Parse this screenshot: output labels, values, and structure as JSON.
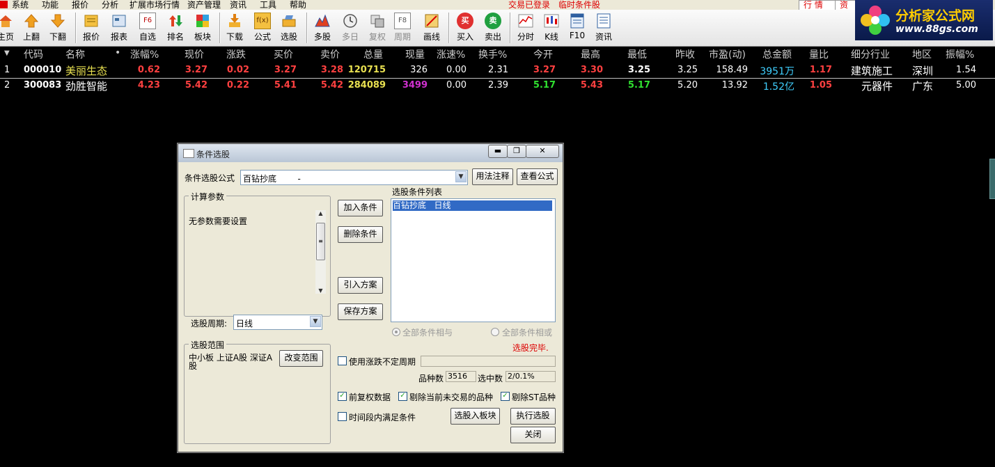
{
  "menubar": {
    "items": [
      "系统",
      "功能",
      "报价",
      "分析",
      "扩展市场行情",
      "资产管理",
      "资讯",
      "工具",
      "帮助"
    ],
    "status_login": "交易已登录",
    "status_temp": "临时条件股",
    "tabs": [
      "行 情",
      "资"
    ]
  },
  "toolbar": {
    "buttons": [
      {
        "label": "主页",
        "icon": "home-icon"
      },
      {
        "label": "上翻",
        "icon": "arrow-up-icon"
      },
      {
        "label": "下翻",
        "icon": "arrow-down-icon"
      },
      {
        "label": "报价",
        "icon": "quote-icon"
      },
      {
        "label": "报表",
        "icon": "report-icon"
      },
      {
        "label": "自选",
        "icon": "f6-key-icon",
        "key": "F6"
      },
      {
        "label": "排名",
        "icon": "ranking-icon"
      },
      {
        "label": "板块",
        "icon": "sector-icon"
      },
      {
        "label": "下载",
        "icon": "download-icon"
      },
      {
        "label": "公式",
        "icon": "formula-icon",
        "key": "f(x)"
      },
      {
        "label": "选股",
        "icon": "stock-pick-icon"
      },
      {
        "label": "多股",
        "icon": "multi-stock-icon"
      },
      {
        "label": "多日",
        "icon": "clock-icon"
      },
      {
        "label": "复权",
        "icon": "restore-icon"
      },
      {
        "label": "周期",
        "icon": "f8-key-icon",
        "key": "F8"
      },
      {
        "label": "画线",
        "icon": "draw-line-icon"
      },
      {
        "label": "买入",
        "icon": "buy-icon",
        "key": "买"
      },
      {
        "label": "卖出",
        "icon": "sell-icon",
        "key": "卖"
      },
      {
        "label": "分时",
        "icon": "intraday-icon"
      },
      {
        "label": "K线",
        "icon": "kline-icon"
      },
      {
        "label": "F10",
        "icon": "f10-icon"
      },
      {
        "label": "资讯",
        "icon": "news-icon"
      }
    ]
  },
  "brand": {
    "title": "分析家公式网",
    "url": "www.88gs.com"
  },
  "table": {
    "headers": [
      "代码",
      "名称",
      "•",
      "涨幅%",
      "现价",
      "涨跌",
      "买价",
      "卖价",
      "总量",
      "现量",
      "涨速%",
      "换手%",
      "今开",
      "最高",
      "最低",
      "昨收",
      "市盈(动)",
      "总金额",
      "量比",
      "细分行业",
      "地区",
      "振幅%"
    ],
    "rows": [
      [
        "1",
        "000010",
        "美丽生态",
        "0.62",
        "3.27",
        "0.02",
        "3.27",
        "3.28",
        "120715",
        "326",
        "0.00",
        "2.31",
        "3.27",
        "3.30",
        "3.25",
        "3.25",
        "158.49",
        "3951万",
        "1.17",
        "建筑施工",
        "深圳",
        "1.54"
      ],
      [
        "2",
        "300083",
        "劲胜智能",
        "4.23",
        "5.42",
        "0.22",
        "5.41",
        "5.42",
        "284089",
        "3499",
        "0.00",
        "2.39",
        "5.17",
        "5.43",
        "5.17",
        "5.20",
        "13.92",
        "1.52亿",
        "1.05",
        "元器件",
        "广东",
        "5.00"
      ]
    ],
    "colors": {
      "red": "#ff4040",
      "green": "#30e030",
      "yellow": "#e8e050",
      "magenta": "#d030d0",
      "cyan": "#40d0ff",
      "white": "#ffffff"
    }
  },
  "dialog": {
    "title": "条件选股",
    "window_buttons": {
      "minimize": "▬",
      "maximize": "❐",
      "close": "✕"
    },
    "formula_label": "条件选股公式",
    "formula_value": "百钻抄底        -",
    "usage_button": "用法注释",
    "view_formula_button": "查看公式",
    "params_group": "计算参数",
    "params_text": "无参数需要设置",
    "period_label": "选股周期:",
    "period_value": "日线",
    "add_button": "加入条件",
    "delete_button": "删除条件",
    "import_button": "引入方案",
    "save_button": "保存方案",
    "conditions_label": "选股条件列表",
    "conditions": [
      "百钻抄底   日线"
    ],
    "radio_and": "全部条件相与",
    "radio_or": "全部条件相或",
    "status": "选股完毕.",
    "scope_group": "选股范围",
    "scope_text": "中小板 上证A股 深证A股",
    "change_scope_button": "改变范围",
    "uncertain_period": "使用涨跌不定周期",
    "count_label": "品种数",
    "count_value": "3516",
    "selected_label": "选中数",
    "selected_value": "2/0.1%",
    "forward_adjust": "前复权数据",
    "exclude_untraded": "剔除当前未交易的品种",
    "exclude_st": "剔除ST品种",
    "time_period": "时间段内满足条件",
    "to_sector_button": "选股入板块",
    "execute_button": "执行选股",
    "close_button": "关闭"
  }
}
